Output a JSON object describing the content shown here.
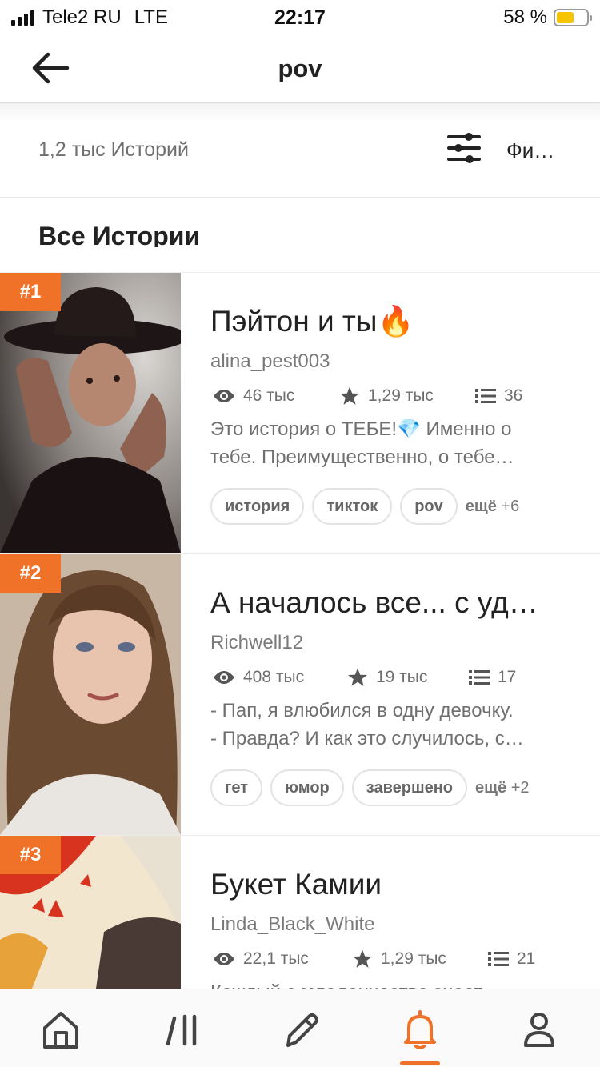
{
  "status_bar": {
    "carrier": "Tele2 RU",
    "network": "LTE",
    "time": "22:17",
    "battery": "58 %",
    "battery_level": 0.58
  },
  "header": {
    "title": "pov",
    "back_icon": "arrow-left-icon"
  },
  "info_bar": {
    "count": "1,2 тыс Историй",
    "filter_icon": "sliders-icon",
    "filter_label": "Фи…"
  },
  "section": {
    "title": "Все Истории"
  },
  "stories": [
    {
      "rank": "#1",
      "title": "Пэйтон и ты🔥",
      "author": "alina_pest003",
      "reads": "46 тыс",
      "votes": "1,29 тыс",
      "parts": "36",
      "description": [
        "Это история о ТЕБЕ!💎 Именно о",
        "тебе. Преимущественно, о тебе…"
      ],
      "tags": [
        "история",
        "тикток",
        "pov"
      ],
      "more_label": "ещё",
      "more_count": "+6"
    },
    {
      "rank": "#2",
      "title": "А началось все... с уд…",
      "author": "Richwell12",
      "reads": "408 тыс",
      "votes": "19 тыс",
      "parts": "17",
      "description": [
        "- Пап, я влюбился в одну девочку.",
        "- Правда? И как это случилось, с…"
      ],
      "tags": [
        "гет",
        "юмор",
        "завершено"
      ],
      "more_label": "ещё",
      "more_count": "+2"
    },
    {
      "rank": "#3",
      "title": "Букет Камии",
      "author": "Linda_Black_White",
      "reads": "22,1 тыс",
      "votes": "1,29 тыс",
      "parts": "21",
      "description": [
        "Каждый с младенчества знает",
        ""
      ],
      "tags": [],
      "more_label": "",
      "more_count": ""
    }
  ],
  "tab_bar": {
    "tabs": [
      "home-icon",
      "library-icon",
      "pencil-icon",
      "bell-icon",
      "profile-icon"
    ],
    "active": "bell-icon",
    "accent": "#f07128"
  }
}
